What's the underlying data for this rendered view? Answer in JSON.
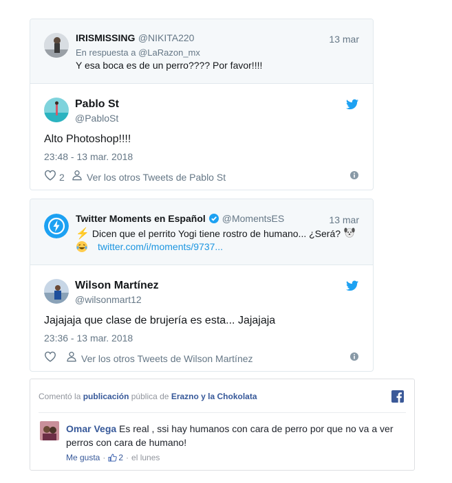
{
  "tweet1": {
    "quoted": {
      "name": "IRISMISSING",
      "handle": "@NIKITA220",
      "date": "13 mar",
      "reply_prefix": "En respuesta a",
      "reply_to": "@LaRazon_mx",
      "text": "Y esa boca es de un perro???? Por favor!!!!"
    },
    "author_name": "Pablo St",
    "author_handle": "@PabloSt",
    "text": "Alto Photoshop!!!!",
    "timestamp": "23:48 - 13 mar. 2018",
    "likes": "2",
    "more_tweets": "Ver los otros Tweets de Pablo St"
  },
  "tweet2": {
    "quoted": {
      "name": "Twitter Moments en Español",
      "handle": "@MomentsES",
      "date": "13 mar",
      "text_line1": "Dicen que el perrito Yogi tiene rostro de humano... ¿Será?",
      "link": "twitter.com/i/moments/9737..."
    },
    "author_name": "Wilson Martínez",
    "author_handle": "@wilsonmart12",
    "text": "Jajajaja que clase de brujería es esta... Jajajaja",
    "timestamp": "23:36 - 13 mar. 2018",
    "more_tweets": "Ver los otros Tweets de Wilson Martínez"
  },
  "fb_comment": {
    "header_prefix": "Comentó la",
    "header_link": "publicación",
    "header_mid": "pública de",
    "header_page": "Erazno y la Chokolata",
    "commenter": "Omar Vega",
    "comment_line1": "Es real , ssi hay humanos con cara de perro por que no va a ver",
    "comment_line2": "perros con cara de humano!",
    "like_label": "Me gusta",
    "like_count": "2",
    "time": "el lunes"
  },
  "colors": {
    "twitter_blue": "#1da1f2",
    "link_blue": "#1b95e0",
    "facebook_blue": "#3b5998",
    "facebook_link": "#365899"
  },
  "icons": [
    "twitter-bird-icon",
    "heart-icon",
    "person-icon",
    "info-icon",
    "lightning-icon",
    "verified-icon",
    "dog-emoji-icon",
    "laughing-emoji-icon",
    "facebook-icon",
    "thumbs-up-icon"
  ]
}
